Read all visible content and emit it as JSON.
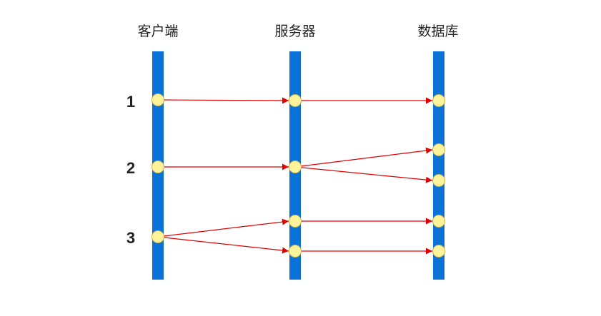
{
  "lanes": [
    {
      "id": "client",
      "title": "客户端"
    },
    {
      "id": "server",
      "title": "服务器"
    },
    {
      "id": "database",
      "title": "数据库"
    }
  ],
  "steps": [
    {
      "id": "1",
      "label": "1"
    },
    {
      "id": "2",
      "label": "2"
    },
    {
      "id": "3",
      "label": "3"
    }
  ],
  "connections": [
    {
      "step": "1",
      "from": "client",
      "to": "server"
    },
    {
      "step": "1",
      "from": "server",
      "to": "database"
    },
    {
      "step": "2",
      "from": "client",
      "to": "server"
    },
    {
      "step": "2",
      "from": "server",
      "to": "database",
      "branch": "upper"
    },
    {
      "step": "2",
      "from": "server",
      "to": "database",
      "branch": "lower"
    },
    {
      "step": "3",
      "from": "client",
      "to": "server",
      "branch": "upper"
    },
    {
      "step": "3",
      "from": "client",
      "to": "server",
      "branch": "lower"
    },
    {
      "step": "3",
      "from": "server",
      "to": "database",
      "branch": "upper"
    },
    {
      "step": "3",
      "from": "server",
      "to": "database",
      "branch": "lower"
    }
  ],
  "colors": {
    "lane": "#0a72d6",
    "node_fill": "#fef39b",
    "edge": "#e00000"
  }
}
